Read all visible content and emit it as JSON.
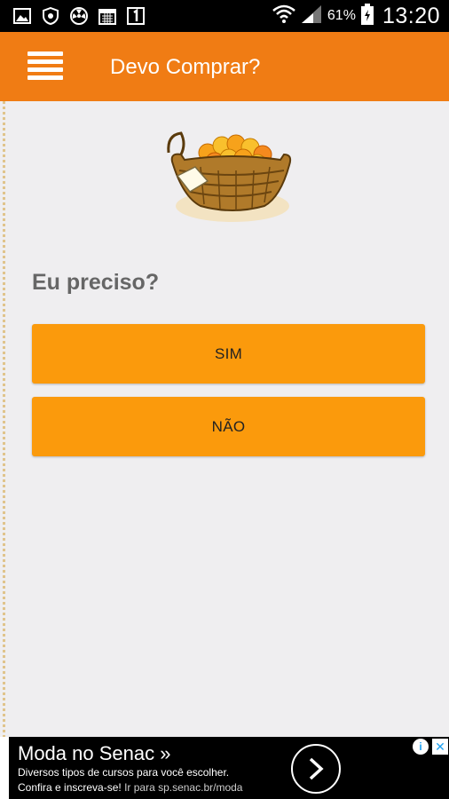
{
  "status_bar": {
    "battery_pct": "61%",
    "time": "13:20",
    "icons": [
      "image-icon",
      "shield-icon",
      "radiation-icon",
      "calendar-icon",
      "notification-1-icon",
      "wifi-icon",
      "signal-icon",
      "battery-icon"
    ]
  },
  "app_bar": {
    "title": "Devo Comprar?",
    "menu_icon": "menu-icon",
    "color": "#f07c14"
  },
  "main": {
    "question": "Eu preciso?",
    "yes_label": "SIM",
    "no_label": "NÃO",
    "button_color": "#fb9a0c"
  },
  "ad": {
    "title": "Moda no Senac »",
    "line1": "Diversos tipos de cursos para você escolher.",
    "line2_main": "Confira e inscreva-se!",
    "line2_url": "Ir para sp.senac.br/moda",
    "arrow_icon": "chevron-right-icon",
    "info_label": "i",
    "close_label": "✕"
  }
}
